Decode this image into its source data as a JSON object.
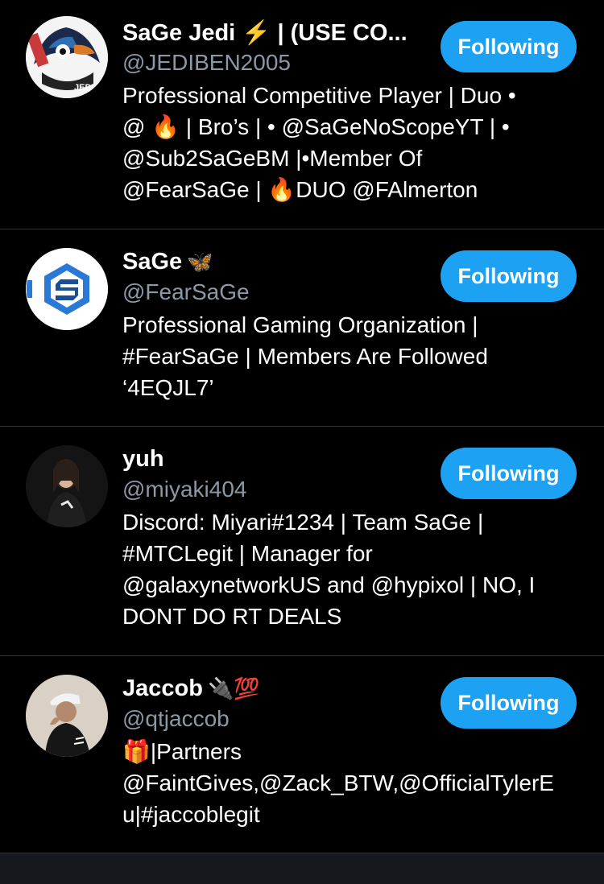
{
  "colors": {
    "background": "#000000",
    "accent": "#1da1f2",
    "handle": "#8b98a5",
    "divider": "#2f3336"
  },
  "users": [
    {
      "name": "SaGe Jedi ⚡️ | (USE CO...",
      "handle": "@JEDIBEN2005",
      "bio_lines": [
        "Professional Competitive Player | Duo •",
        "@ 🔥 | Bro’s | • @SaGeNoScopeYT | •",
        "@Sub2SaGeBM |•Member Of",
        "@FearSaGe | 🔥DUO @FAlmerton"
      ],
      "button_label": "Following",
      "avatar_icon": "fox-jedi-avatar",
      "avatar_text": "JEDI"
    },
    {
      "name": "SaGe",
      "name_emoji": "🦋",
      "handle": "@FearSaGe",
      "bio_lines": [
        "Professional Gaming Organization |",
        "#FearSaGe | Members Are Followed",
        "‘4EQJL7’"
      ],
      "button_label": "Following",
      "avatar_icon": "sage-logo-avatar"
    },
    {
      "name": "yuh",
      "handle": "@miyaki404",
      "bio_lines": [
        "Discord: Miyari#1234 | Team SaGe |",
        "#MTCLegit | Manager for",
        "@galaxynetworkUS and @hypixol | NO, I",
        "DONT DO RT DEALS"
      ],
      "button_label": "Following",
      "avatar_icon": "person-photo-avatar"
    },
    {
      "name": "Jaccob",
      "name_emoji": "🔌💯",
      "handle": "@qtjaccob",
      "bio_lines": [
        "🎁|Partners",
        "@FaintGives,@Zack_BTW,@OfficialTylerE",
        "u|#jaccoblegit"
      ],
      "button_label": "Following",
      "avatar_icon": "person-photo-avatar"
    }
  ]
}
